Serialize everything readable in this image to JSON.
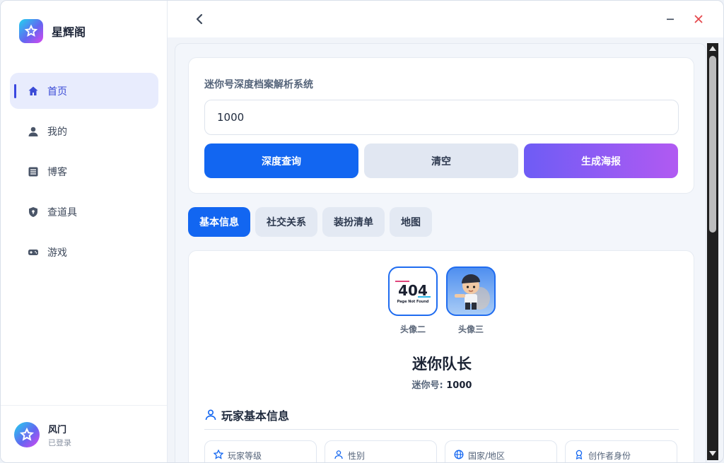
{
  "app": {
    "name": "星辉阁"
  },
  "sidebar": {
    "items": [
      {
        "label": "首页",
        "icon": "home-icon",
        "active": true
      },
      {
        "label": "我的",
        "icon": "user-icon",
        "active": false
      },
      {
        "label": "博客",
        "icon": "document-icon",
        "active": false
      },
      {
        "label": "查道具",
        "icon": "shield-icon",
        "active": false
      },
      {
        "label": "游戏",
        "icon": "gamepad-icon",
        "active": false
      }
    ]
  },
  "user": {
    "name": "风门",
    "status": "已登录"
  },
  "search": {
    "title": "迷你号深度档案解析系统",
    "value": "1000",
    "buttons": {
      "query": "深度查询",
      "clear": "清空",
      "poster": "生成海报"
    }
  },
  "tabs": [
    {
      "label": "基本信息",
      "active": true
    },
    {
      "label": "社交关系",
      "active": false
    },
    {
      "label": "装扮清单",
      "active": false
    },
    {
      "label": "地图",
      "active": false
    }
  ],
  "profile": {
    "avatars": [
      {
        "label": "头像二",
        "image_text": "404",
        "image_subtext": "Page Not Found"
      },
      {
        "label": "头像三"
      }
    ],
    "name": "迷你队长",
    "id_label": "迷你号:",
    "id_value": "1000",
    "section_title": "玩家基本信息",
    "fields": [
      {
        "label": "玩家等级",
        "icon": "star-icon"
      },
      {
        "label": "性别",
        "icon": "person-icon"
      },
      {
        "label": "国家/地区",
        "icon": "globe-icon"
      },
      {
        "label": "创作者身份",
        "icon": "badge-icon"
      }
    ]
  },
  "colors": {
    "primary": "#1266f1",
    "active_nav": "#3b4bd6",
    "close": "#e5484d"
  }
}
